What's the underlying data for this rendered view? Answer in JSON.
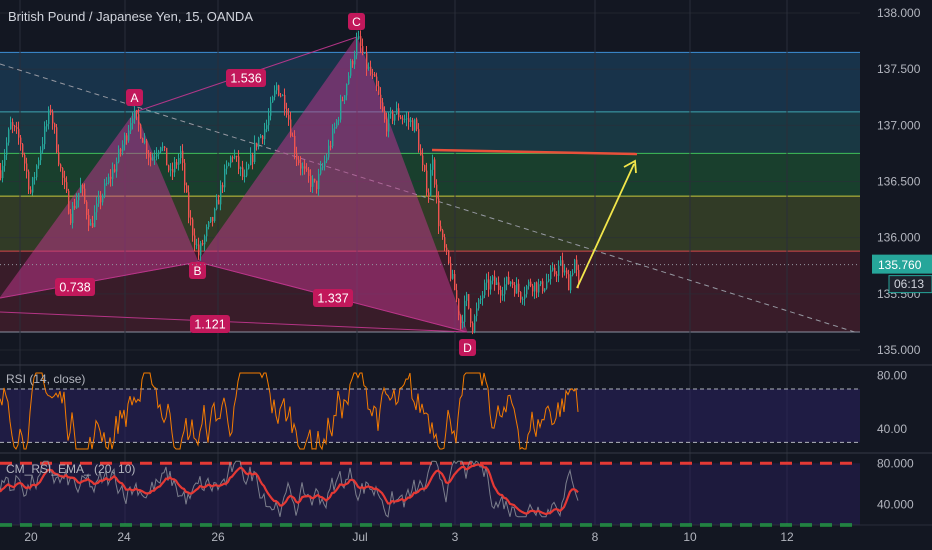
{
  "header": {
    "title": "British Pound / Japanese Yen, 15, OANDA"
  },
  "colors": {
    "background": "#131722",
    "bull": "#26a69a",
    "bear": "#ef5350",
    "harmonic_fill": "#c2378f",
    "harmonic_label_bg": "#c2185b",
    "arrow": "#f2e64b",
    "target_line": "#e8503a",
    "rsi_line": "#f57c00",
    "cm_rsi_line": "#e53935",
    "cm_rsi_raw": "#9598a1",
    "upper_band": "#e53935",
    "lower_band": "#1fd14a",
    "price_badge": "#26a69a"
  },
  "chart_data": [
    {
      "type": "line",
      "title": "British Pound / Japanese Yen, 15, OANDA",
      "ylim": [
        134.95,
        138.1
      ],
      "y_ticks": [
        "138.000",
        "137.500",
        "137.000",
        "136.500",
        "136.000",
        "135.000"
      ],
      "current_price": "135.760",
      "countdown": "06:13",
      "x_ticks": [
        "20",
        "24",
        "26",
        "Jul",
        "3",
        "8",
        "10",
        "12"
      ],
      "price_path": [
        [
          0,
          136.6
        ],
        [
          10,
          137.0
        ],
        [
          20,
          136.85
        ],
        [
          30,
          136.4
        ],
        [
          40,
          136.8
        ],
        [
          50,
          137.15
        ],
        [
          60,
          136.6
        ],
        [
          70,
          136.2
        ],
        [
          80,
          136.45
        ],
        [
          90,
          136.1
        ],
        [
          100,
          136.35
        ],
        [
          115,
          136.65
        ],
        [
          125,
          136.9
        ],
        [
          132,
          137.12
        ],
        [
          140,
          136.95
        ],
        [
          150,
          136.7
        ],
        [
          160,
          136.85
        ],
        [
          170,
          136.55
        ],
        [
          180,
          136.75
        ],
        [
          188,
          136.2
        ],
        [
          198,
          135.85
        ],
        [
          206,
          136.05
        ],
        [
          214,
          136.2
        ],
        [
          222,
          136.5
        ],
        [
          232,
          136.75
        ],
        [
          244,
          136.5
        ],
        [
          256,
          136.85
        ],
        [
          266,
          137.0
        ],
        [
          276,
          137.35
        ],
        [
          285,
          137.2
        ],
        [
          295,
          136.75
        ],
        [
          305,
          136.55
        ],
        [
          315,
          136.45
        ],
        [
          325,
          136.7
        ],
        [
          335,
          137.0
        ],
        [
          345,
          137.35
        ],
        [
          357,
          137.77
        ],
        [
          365,
          137.55
        ],
        [
          375,
          137.35
        ],
        [
          385,
          137.0
        ],
        [
          395,
          137.12
        ],
        [
          405,
          137.05
        ],
        [
          415,
          137.0
        ],
        [
          422,
          136.6
        ],
        [
          428,
          136.4
        ],
        [
          432,
          136.75
        ],
        [
          437,
          136.2
        ],
        [
          442,
          135.95
        ],
        [
          448,
          135.75
        ],
        [
          455,
          135.5
        ],
        [
          460,
          135.25
        ],
        [
          466,
          135.45
        ],
        [
          472,
          135.22
        ],
        [
          478,
          135.4
        ],
        [
          484,
          135.55
        ],
        [
          492,
          135.6
        ],
        [
          500,
          135.55
        ],
        [
          510,
          135.62
        ],
        [
          520,
          135.5
        ],
        [
          530,
          135.6
        ],
        [
          540,
          135.55
        ],
        [
          550,
          135.65
        ],
        [
          560,
          135.75
        ],
        [
          568,
          135.6
        ],
        [
          574,
          135.8
        ],
        [
          578,
          135.55
        ]
      ]
    },
    {
      "type": "line",
      "title": "RSI (14, close)",
      "ylim": [
        22,
        88
      ],
      "y_ticks": [
        "80.00",
        "40.00"
      ],
      "bands": [
        70,
        30
      ]
    },
    {
      "type": "line",
      "title": "CM_RSI_EMA_ (20, 10)",
      "ylim": [
        20,
        90
      ],
      "y_ticks": [
        "80.000",
        "40.000"
      ],
      "bands": [
        80,
        20
      ]
    }
  ],
  "annotations": {
    "points": {
      "A": "A",
      "B": "B",
      "C": "C",
      "D": "D"
    },
    "ratios": {
      "ac": "1.536",
      "xb": "0.738",
      "bd": "1.337",
      "xd": "1.121"
    }
  }
}
